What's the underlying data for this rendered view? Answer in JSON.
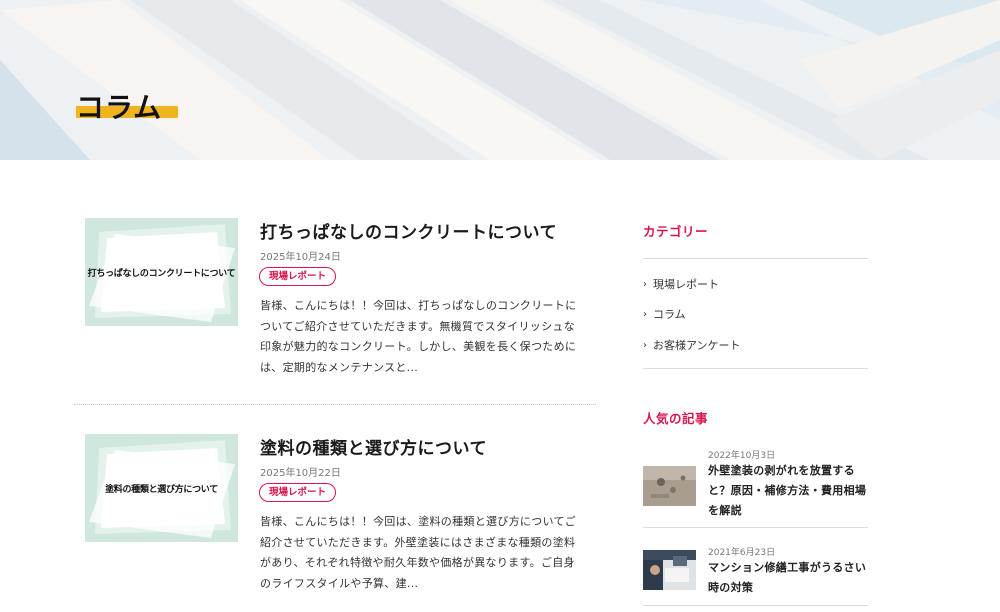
{
  "hero": {
    "title": "コラム"
  },
  "articles": [
    {
      "thumb_text": "打ちっぱなしのコンクリートについて",
      "title": "打ちっぱなしのコンクリートについて",
      "date": "2025年10月24日",
      "tag": "現場レポート",
      "excerpt_lines": [
        "皆様、こんにちは！！今回は、打ちっぱなしのコンクリートに",
        "ついてご紹介させていただきます。無機質でスタイリッシュな",
        "印象が魅力的なコンクリート。しかし、美観を長く保つために",
        "は、定期的なメンテナンスと..."
      ]
    },
    {
      "thumb_text": "塗料の種類と選び方について",
      "title": "塗料の種類と選び方について",
      "date": "2025年10月22日",
      "tag": "現場レポート",
      "excerpt_lines": [
        "皆様、こんにちは！！今回は、塗料の種類と選び方についてご",
        "紹介させていただきます。外壁塗装にはさまざまな種類の塗料",
        "があり、それぞれ特徴や耐久年数や価格が異なります。ご自身",
        "のライフスタイルや予算、建..."
      ]
    }
  ],
  "sidebar": {
    "category_heading": "カテゴリー",
    "categories": [
      "現場レポート",
      "コラム",
      "お客様アンケート"
    ],
    "popular_heading": "人気の記事",
    "popular": [
      {
        "date": "2022年10月3日",
        "title_lines": [
          "外壁塗装の剥がれを放置する",
          "と？原因・補修方法・費用相場",
          "を解説"
        ]
      },
      {
        "date": "2021年6月23日",
        "title_lines": [
          "マンション修繕工事がうるさい",
          "時の対策"
        ]
      }
    ]
  },
  "colors": {
    "accent": "#d8154e",
    "title_bar": "#f0b51e",
    "thumb_bg": "#cfe7dc"
  }
}
